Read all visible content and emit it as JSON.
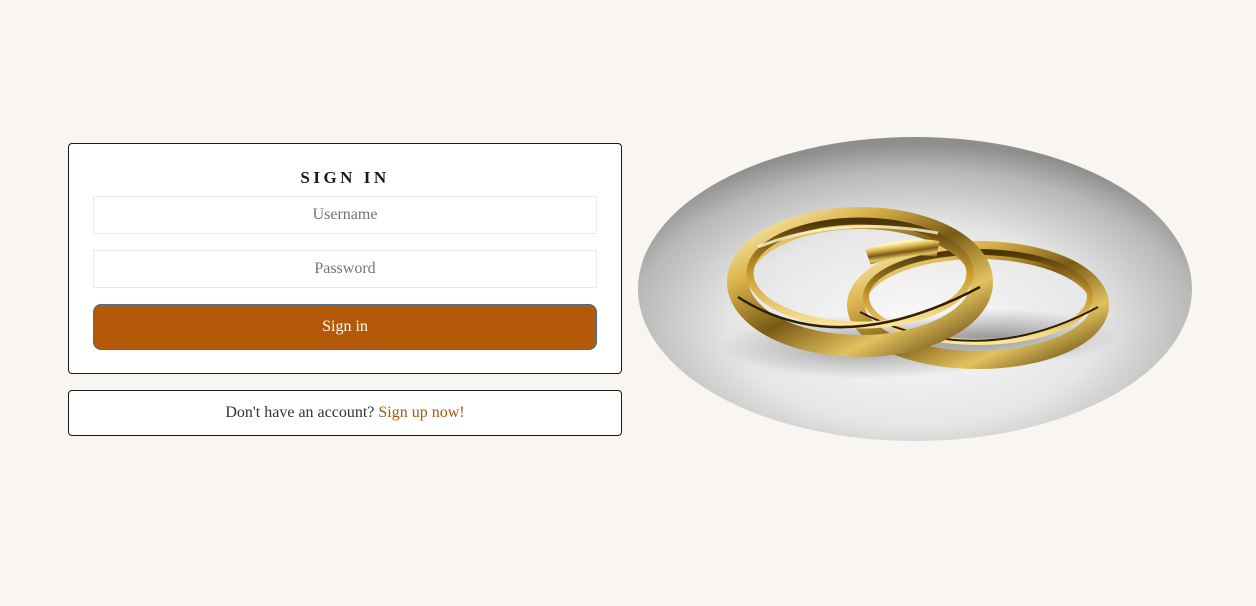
{
  "signin": {
    "title": "SIGN IN",
    "username_placeholder": "Username",
    "password_placeholder": "Password",
    "button_label": "Sign in"
  },
  "signup": {
    "prompt": "Don't have an account?",
    "link_label": "Sign up now!"
  },
  "hero_image": {
    "icon": "wedding-rings-image"
  },
  "colors": {
    "background": "#f9f6f1",
    "accent": "#b35907",
    "link": "#a8560c"
  }
}
